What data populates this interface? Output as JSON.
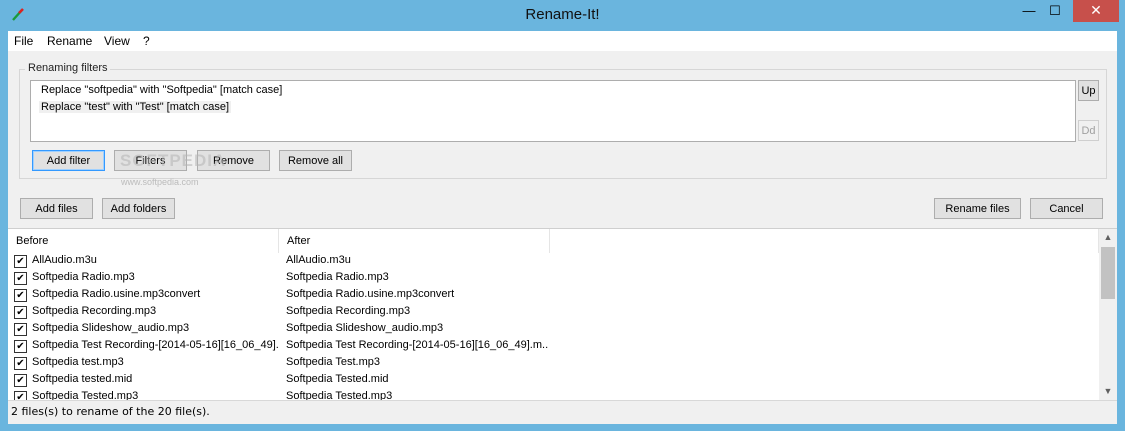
{
  "window": {
    "title": "Rename-It!",
    "icon": "rename-it-app-icon",
    "controls": {
      "minimize": "—",
      "maximize": "☐",
      "close": "✕"
    }
  },
  "menu": [
    "File",
    "Rename",
    "View",
    "?"
  ],
  "filters": {
    "group_label": "Renaming filters",
    "items": [
      "Replace \"softpedia\" with \"Softpedia\" [match case]",
      "Replace \"test\" with \"Test\" [match case]"
    ],
    "up_label": "Up",
    "down_label": "Dd",
    "add_filter": "Add filter",
    "filters_btn": "Filters",
    "remove": "Remove",
    "remove_all": "Remove all"
  },
  "watermark": {
    "text": "SOFTPEDIA",
    "url": "www.softpedia.com"
  },
  "actions": {
    "add_files": "Add files",
    "add_folders": "Add folders",
    "rename_files": "Rename files",
    "cancel": "Cancel"
  },
  "files": {
    "columns": [
      "Before",
      "After"
    ],
    "rows": [
      {
        "checked": true,
        "before": "AllAudio.m3u",
        "after": "AllAudio.m3u"
      },
      {
        "checked": true,
        "before": "Softpedia Radio.mp3",
        "after": "Softpedia Radio.mp3"
      },
      {
        "checked": true,
        "before": "Softpedia Radio.usine.mp3convert",
        "after": "Softpedia Radio.usine.mp3convert"
      },
      {
        "checked": true,
        "before": "Softpedia Recording.mp3",
        "after": "Softpedia Recording.mp3"
      },
      {
        "checked": true,
        "before": "Softpedia Slideshow_audio.mp3",
        "after": "Softpedia Slideshow_audio.mp3"
      },
      {
        "checked": true,
        "before": "Softpedia Test Recording-[2014-05-16][16_06_49]...",
        "after": "Softpedia Test Recording-[2014-05-16][16_06_49].m..."
      },
      {
        "checked": true,
        "before": "Softpedia test.mp3",
        "after": "Softpedia Test.mp3"
      },
      {
        "checked": true,
        "before": "Softpedia tested.mid",
        "after": "Softpedia Tested.mid"
      },
      {
        "checked": true,
        "before": "Softpedia Tested.mp3",
        "after": "Softpedia Tested.mp3"
      }
    ]
  },
  "status": "2 files(s) to rename of the 20 file(s)."
}
